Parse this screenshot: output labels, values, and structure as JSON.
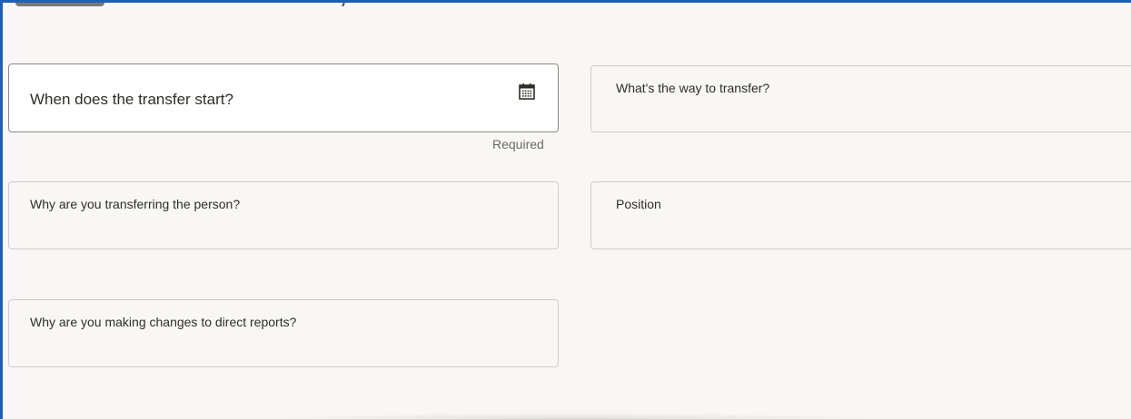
{
  "form": {
    "start_date": {
      "label": "When does the transfer start?",
      "helper": "Required",
      "icon": "calendar-icon"
    },
    "transfer_way": {
      "label": "What's the way to transfer?"
    },
    "transfer_reason": {
      "label": "Why are you transferring the person?"
    },
    "position": {
      "label": "Position"
    },
    "direct_reports_reason": {
      "label": "Why are you making changes to direct reports?"
    }
  },
  "colors": {
    "accent_border": "#1f5fb6",
    "page_background": "#f8f7f6",
    "field_border": "#cfcdc9"
  }
}
